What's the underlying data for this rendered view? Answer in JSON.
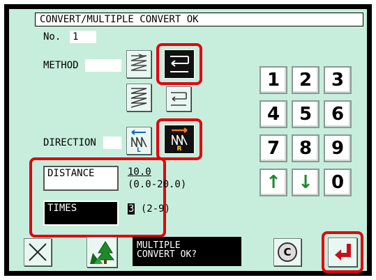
{
  "title": "CONVERT/MULTIPLE CONVERT OK",
  "pattern": {
    "label": "No.",
    "number": "1"
  },
  "method": {
    "label": "METHOD",
    "options": [
      "zigzag-reverse",
      "return-flat",
      "zigzag-forward",
      "return-alt"
    ],
    "selected": "return-flat"
  },
  "direction": {
    "label": "DIRECTION",
    "options": [
      {
        "name": "left",
        "tag": "L"
      },
      {
        "name": "right",
        "tag": "R"
      }
    ],
    "selected": "right"
  },
  "distance": {
    "label": "DISTANCE",
    "value": "10.0",
    "range": "(0.0-20.0)"
  },
  "times": {
    "label": "TIMES",
    "value": "3",
    "range": "(2-9)"
  },
  "keypad": {
    "keys": [
      "1",
      "2",
      "3",
      "4",
      "5",
      "6",
      "7",
      "8",
      "9",
      "↑",
      "↓",
      "0"
    ]
  },
  "footer": {
    "message_line1": "MULTIPLE",
    "message_line2": "CONVERT OK?",
    "clear_label": "C"
  },
  "colors": {
    "background": "#c7eedc",
    "highlight": "#e3000f",
    "selected": "#111111"
  }
}
